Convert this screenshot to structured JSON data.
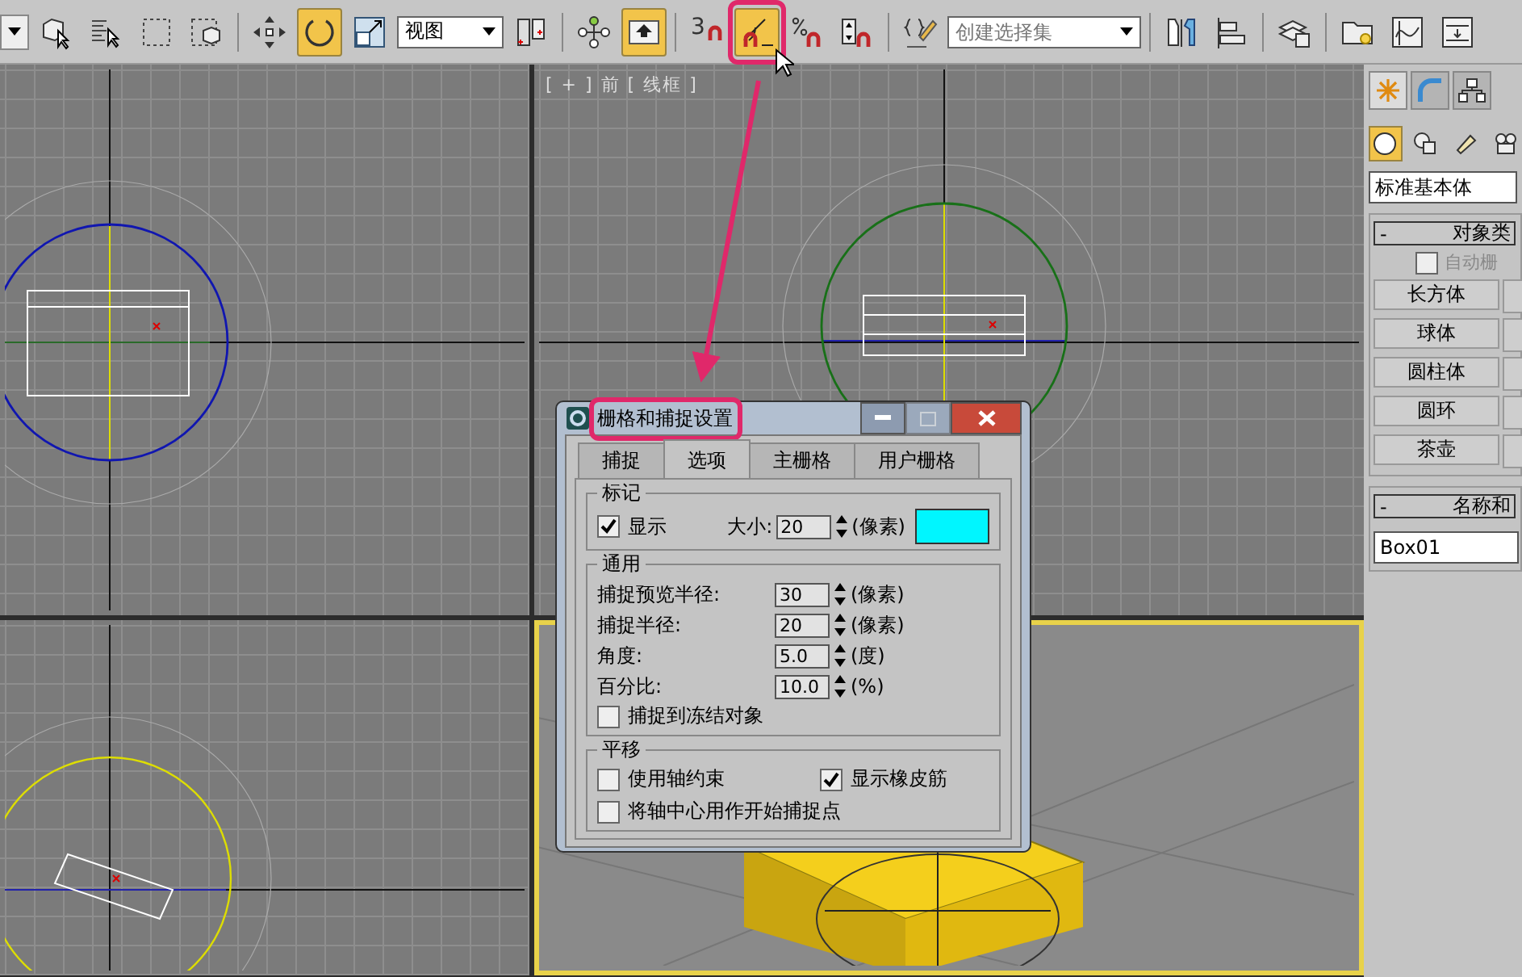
{
  "toolbar": {
    "groups": [
      {
        "items": [
          {
            "kind": "caret-stub"
          },
          {
            "kind": "select",
            "on": false
          },
          {
            "kind": "select-by-name",
            "on": false
          },
          {
            "kind": "region",
            "on": false
          },
          {
            "kind": "crossing",
            "on": false
          }
        ]
      },
      {
        "items": [
          {
            "kind": "move",
            "on": false
          },
          {
            "kind": "rotate",
            "on": true
          },
          {
            "kind": "scale",
            "on": false
          },
          {
            "kind": "dropdown",
            "text": "视图"
          },
          {
            "kind": "pivot",
            "on": false
          }
        ]
      },
      {
        "items": [
          {
            "kind": "manipulate",
            "on": false
          },
          {
            "kind": "place",
            "on": true
          }
        ]
      },
      {
        "items": [
          {
            "kind": "snap",
            "on": false,
            "text": "3"
          },
          {
            "kind": "angle-snap",
            "on": true
          },
          {
            "kind": "percent-snap",
            "on": false
          },
          {
            "kind": "spinner-snap",
            "on": false
          }
        ]
      },
      {
        "items": [
          {
            "kind": "named-sets",
            "on": false
          },
          {
            "kind": "selection-set",
            "placeholder": "创建选择集"
          }
        ]
      },
      {
        "items": [
          {
            "kind": "mirror",
            "on": false
          },
          {
            "kind": "align",
            "on": false
          }
        ]
      },
      {
        "items": [
          {
            "kind": "layers",
            "on": false
          }
        ]
      },
      {
        "items": [
          {
            "kind": "explorer",
            "on": false
          },
          {
            "kind": "curve-editor",
            "on": false
          },
          {
            "kind": "schematic",
            "on": false
          }
        ]
      }
    ]
  },
  "viewports": [
    {
      "kind": "top",
      "active": false
    },
    {
      "kind": "front",
      "active": false,
      "label": "[ + ] 前 [ 线框 ]"
    },
    {
      "kind": "left",
      "active": false
    },
    {
      "kind": "perspective",
      "active": true
    }
  ],
  "dialog": {
    "title": "栅格和捕捉设置",
    "tabs": [
      {
        "label": "捕捉",
        "selected": false
      },
      {
        "label": "选项",
        "selected": true
      },
      {
        "label": "主栅格",
        "selected": false
      },
      {
        "label": "用户栅格",
        "selected": false
      }
    ],
    "marker": {
      "title": "标记",
      "show": {
        "label": "显示",
        "checked": true
      },
      "size_label": "大小:",
      "size": "20",
      "size_unit": "(像素)",
      "color": "#00f6ff"
    },
    "general": {
      "title": "通用",
      "rows": [
        {
          "label": "捕捉预览半径:",
          "value": "30",
          "unit": "(像素)"
        },
        {
          "label": "捕捉半径:",
          "value": "20",
          "unit": "(像素)"
        },
        {
          "label": "角度:",
          "value": "5.0",
          "unit": "(度)"
        },
        {
          "label": "百分比:",
          "value": "10.0",
          "unit": "(%)"
        }
      ],
      "frozen": {
        "label": "捕捉到冻结对象",
        "checked": false
      }
    },
    "translation": {
      "title": "平移",
      "options": [
        {
          "label": "使用轴约束",
          "checked": false
        },
        {
          "label": "显示橡皮筋",
          "checked": true
        },
        {
          "label": "将轴中心用作开始捕捉点",
          "checked": false
        }
      ]
    }
  },
  "command_panel": {
    "tabs": [
      {
        "kind": "create",
        "selected": true
      },
      {
        "kind": "modify",
        "selected": false
      },
      {
        "kind": "hierarchy",
        "selected": false
      }
    ],
    "categories": [
      {
        "kind": "geometry",
        "selected": true
      },
      {
        "kind": "shapes",
        "selected": false
      },
      {
        "kind": "lights",
        "selected": false
      },
      {
        "kind": "cameras",
        "selected": false
      }
    ],
    "type_dropdown": "标准基本体",
    "object_type": {
      "toggle": "-",
      "title": "对象类",
      "autogrid": {
        "label": "自动栅",
        "checked": false,
        "disabled": true
      },
      "buttons": [
        "长方体",
        "球体",
        "圆柱体",
        "圆环",
        "茶壶"
      ]
    },
    "name_color": {
      "toggle": "-",
      "title": "名称和",
      "name": "Box01"
    }
  }
}
